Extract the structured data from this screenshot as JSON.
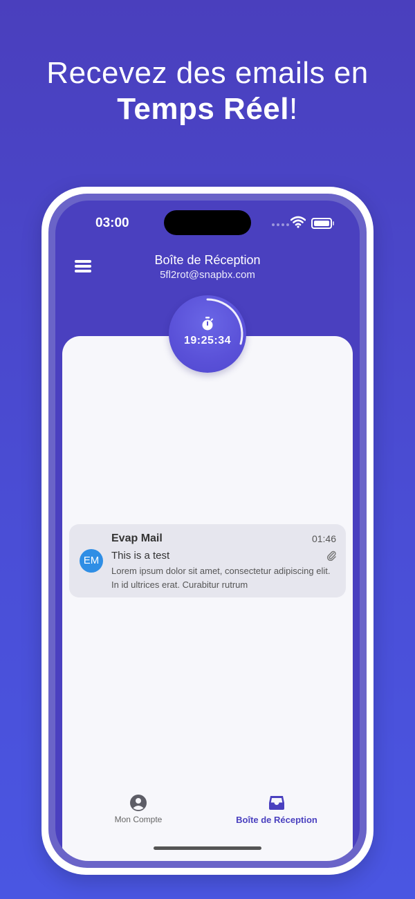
{
  "headline": {
    "line1": "Recevez des emails en",
    "line2_bold": "Temps Réel",
    "line2_suffix": "!"
  },
  "status_bar": {
    "time": "03:00"
  },
  "header": {
    "title": "Boîte de Réception",
    "email": "5fl2rot@snapbx.com"
  },
  "timer": {
    "value": "19:25:34"
  },
  "inbox": {
    "items": [
      {
        "avatar_initials": "EM",
        "sender": "Evap Mail",
        "time": "01:46",
        "subject": "This is a test",
        "preview": "Lorem ipsum dolor sit amet, consectetur adipiscing elit. In id ultrices erat. Curabitur rutrum",
        "has_attachment": true
      }
    ]
  },
  "tabs": [
    {
      "label": "Mon Compte",
      "icon": "account-icon",
      "active": false
    },
    {
      "label": "Boîte de Réception",
      "icon": "inbox-icon",
      "active": true
    }
  ],
  "colors": {
    "background": "#4a40bf",
    "panel": "#f7f7fb",
    "avatar": "#2f8ee5",
    "accent": "#4a40bf",
    "mail_item": "#e6e6ee"
  }
}
